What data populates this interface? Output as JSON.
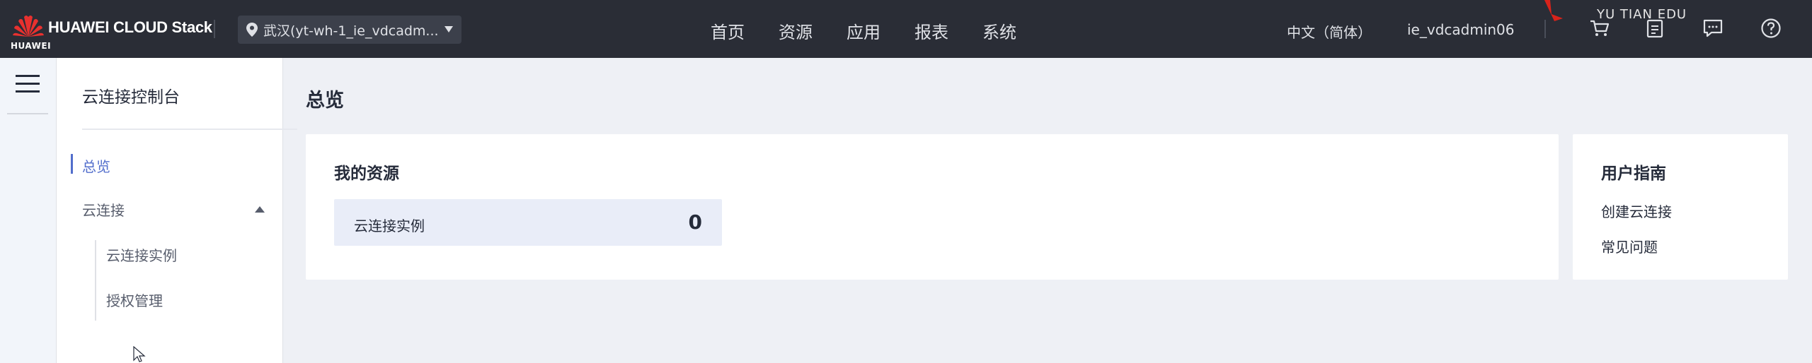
{
  "header": {
    "logo_text": "HUAWEI",
    "brand": "HUAWEI CLOUD Stack",
    "region": "武汉(yt-wh-1_ie_vdcadm...",
    "nav": [
      "首页",
      "资源",
      "应用",
      "报表",
      "系统"
    ],
    "language": "中文（简体）",
    "username": "ie_vdcadmin06",
    "watermark": "YU TIAN EDU",
    "icons": [
      "cart-icon",
      "clipboard-icon",
      "message-icon",
      "help-icon"
    ]
  },
  "sidebar": {
    "title": "云连接控制台",
    "items": [
      {
        "label": "总览",
        "active": true
      },
      {
        "label": "云连接",
        "expanded": true
      },
      {
        "label": "云连接实例"
      },
      {
        "label": "授权管理"
      }
    ]
  },
  "main": {
    "page_title": "总览",
    "resources": {
      "title": "我的资源",
      "items": [
        {
          "label": "云连接实例",
          "count": "0"
        }
      ]
    },
    "guide": {
      "title": "用户指南",
      "links": [
        "创建云连接",
        "常见问题"
      ]
    }
  },
  "colors": {
    "topbar": "#2a2d36",
    "accent": "#526ecc",
    "background": "#eef0f5",
    "resource_box": "#e9edf8"
  }
}
